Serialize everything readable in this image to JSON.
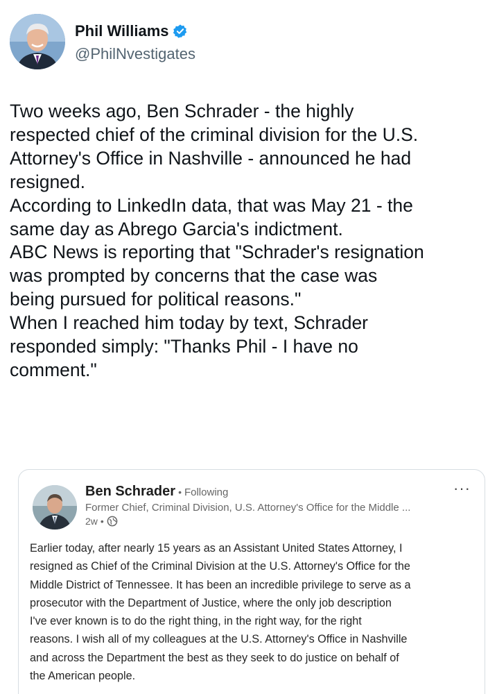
{
  "tweet": {
    "author_name": "Phil Williams",
    "author_handle": "@PhilNvestigates",
    "verified_icon": "verified-badge-icon",
    "verified_color": "#1d9bf0",
    "body_lines": [
      "Two weeks ago, Ben Schrader - the highly",
      "respected chief of the criminal division for the U.S.",
      "Attorney's Office in Nashville - announced he had",
      "resigned.",
      "According to LinkedIn data, that was May 21 - the",
      "same day as Abrego Garcia's indictment.",
      "ABC News is reporting that \"Schrader's resignation",
      "was prompted by concerns that the case was",
      "being pursued for political reasons.\"",
      "When I reached him today by text, Schrader",
      "responded simply: \"Thanks Phil - I have no",
      "comment.\""
    ]
  },
  "quote": {
    "name": "Ben Schrader",
    "separator": "•",
    "follow_status": "Following",
    "headline": "Former Chief, Criminal Division, U.S. Attorney's Office for the Middle ...",
    "age": "2w",
    "meta_dot": "•",
    "visibility_icon": "globe-icon",
    "more_icon": "more-options-icon",
    "more_glyph": "···",
    "text_lines": [
      "Earlier today, after nearly 15 years as an Assistant United States Attorney, I",
      "resigned as Chief of the Criminal Division at the U.S. Attorney's Office for the",
      "Middle District of Tennessee. It has been an incredible privilege to serve as a",
      "prosecutor with the Department of Justice, where the only job description",
      "I've ever known is to do the right thing, in the right way, for the right",
      "reasons. I wish all of my colleagues at the U.S. Attorney's Office in Nashville",
      "and across the Department the best as they seek to do justice on behalf of",
      "the American people."
    ]
  }
}
